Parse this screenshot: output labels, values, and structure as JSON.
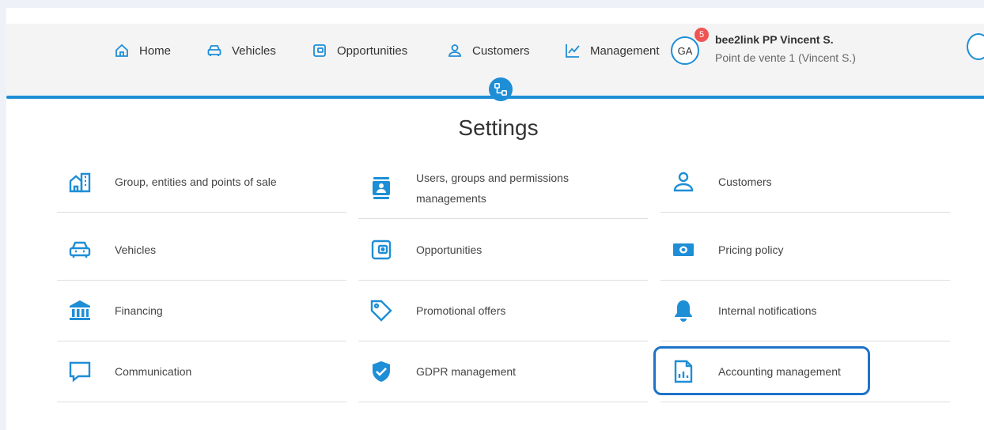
{
  "nav": {
    "items": [
      {
        "label": "Home",
        "icon": "home-icon"
      },
      {
        "label": "Vehicles",
        "icon": "car-icon"
      },
      {
        "label": "Opportunities",
        "icon": "wallet-icon"
      },
      {
        "label": "Customers",
        "icon": "person-icon"
      },
      {
        "label": "Management",
        "icon": "chart-line-icon"
      }
    ]
  },
  "user": {
    "initials": "GA",
    "badge_count": "5",
    "name": "bee2link PP Vincent S.",
    "point_of_sale": "Point de vente 1 (Vincent S.)"
  },
  "page": {
    "title": "Settings"
  },
  "settings": {
    "col1": [
      {
        "label": "Group, entities and points of sale",
        "icon": "building-icon"
      },
      {
        "label": "Vehicles",
        "icon": "car-icon"
      },
      {
        "label": "Financing",
        "icon": "bank-icon"
      },
      {
        "label": "Communication",
        "icon": "chat-icon"
      }
    ],
    "col2": [
      {
        "label": "Users, groups and permissions managements",
        "icon": "id-badge-icon"
      },
      {
        "label": "Opportunities",
        "icon": "wallet-icon"
      },
      {
        "label": "Promotional offers",
        "icon": "tag-icon"
      },
      {
        "label": "GDPR management",
        "icon": "shield-check-icon"
      }
    ],
    "col3": [
      {
        "label": "Customers",
        "icon": "person-icon"
      },
      {
        "label": "Pricing policy",
        "icon": "banknote-icon"
      },
      {
        "label": "Internal notifications",
        "icon": "bell-icon"
      },
      {
        "label": "Accounting management",
        "icon": "report-file-icon"
      }
    ]
  },
  "colors": {
    "accent": "#1e8ed6",
    "badge": "#ee5553",
    "highlight": "#1e73c8"
  }
}
